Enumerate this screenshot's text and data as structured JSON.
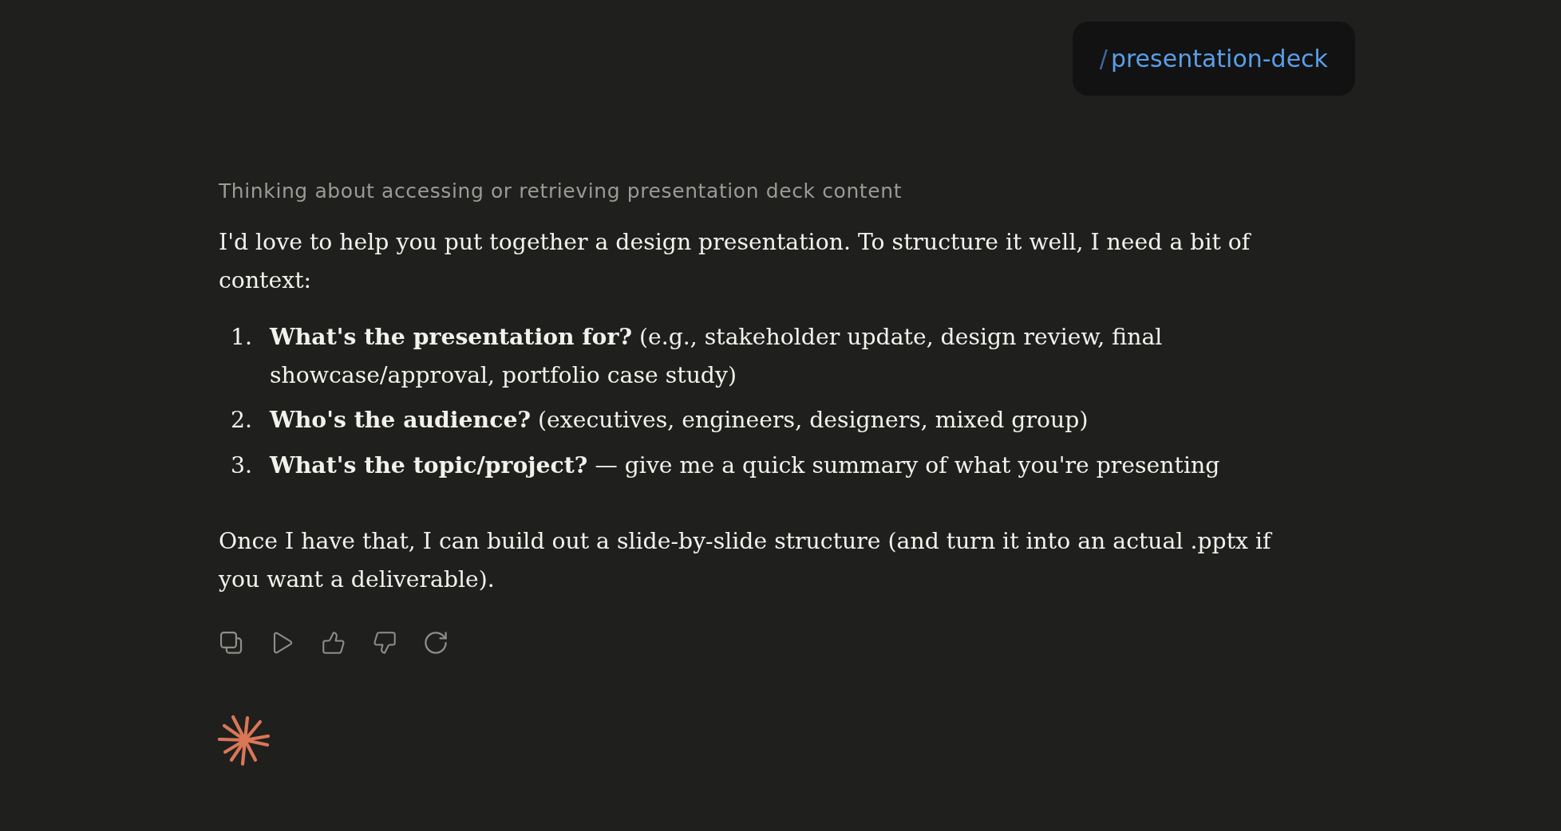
{
  "user_message": {
    "prefix": "/",
    "command": "presentation-deck"
  },
  "thinking_summary": "Thinking about accessing or retrieving presentation deck content",
  "response": {
    "intro": "I'd love to help you put together a design presentation. To structure it well, I need a bit of context:",
    "questions": [
      {
        "number": "1.",
        "text": "**What's the presentation for?** (e.g., stakeholder update, design review, final showcase/approval, portfolio case study)"
      },
      {
        "number": "2.",
        "text": "**Who's the audience?** (executives, engineers, designers, mixed group)"
      },
      {
        "number": "3.",
        "text": "**What's the topic/project?** — give me a quick summary of what you're presenting"
      }
    ],
    "closing": "Once I have that, I can build out a slide-by-slide structure (and turn it into an actual .pptx if you want a deliverable)."
  }
}
